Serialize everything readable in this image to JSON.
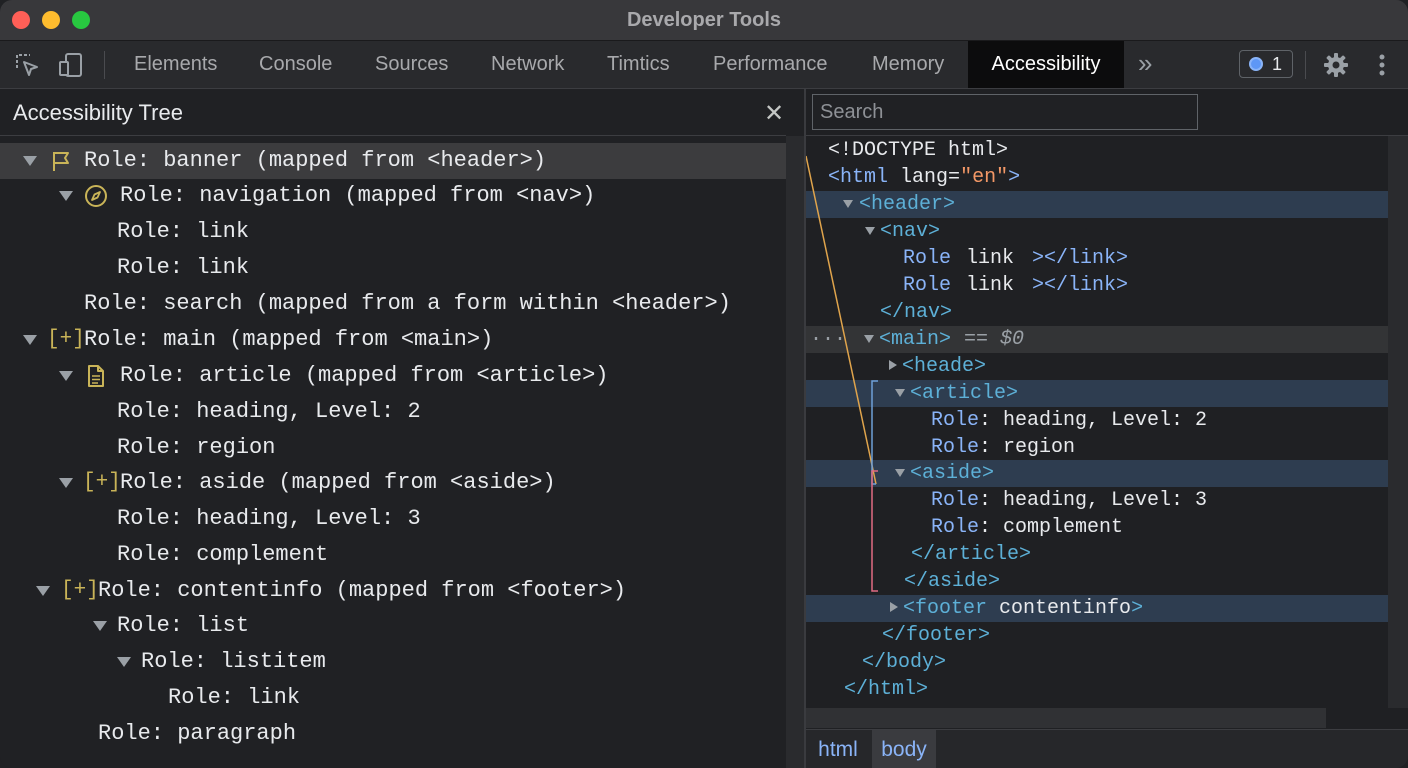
{
  "window": {
    "title": "Developer Tools"
  },
  "tabs": [
    "Elements",
    "Console",
    "Sources",
    "Network",
    "Timtics",
    "Performance",
    "Memory",
    "Accessibility"
  ],
  "active_tab": "Accessibility",
  "badge_count": "1",
  "left_pane": {
    "title": "Accessibility Tree",
    "rows": [
      "Role: banner (mapped from <header>)",
      "Role: navigation (mapped from <nav>)",
      "Role: link",
      "Role: link",
      "Role: search (mapped from a form within <header>)",
      "Role: main (mapped from <main>)",
      "Role: article (mapped from <article>)",
      "Role: heading, Level: 2",
      "Role: region",
      "Role: aside (mapped from <aside>)",
      "Role: heading, Level: 3",
      "Role: complement",
      "Role: contentinfo (mapped from <footer>)",
      "Role: list",
      "Role: listitem",
      "Role: link",
      "Role: paragraph"
    ],
    "plus_marker": "[+]"
  },
  "right_pane": {
    "search_placeholder": "Search",
    "dom": {
      "doctype": "<!DOCTYPE html>",
      "html_open": "<html",
      "html_attr": "lang",
      "html_eq": "=",
      "html_val": "\"en\"",
      "html_close": ">",
      "header": "<header>",
      "nav": "<nav>",
      "role_word": "Role",
      "link_word": "link",
      "link_close": "></link>",
      "link_close2": "></link>",
      "nav_end": "</nav>",
      "ellipsis": "···",
      "main": "<main>",
      "main_sel": "== $0",
      "heade": "<heade>",
      "article": "<article>",
      "r1_role": "Role",
      "r1_rest": ": heading, Level: 2",
      "r2_role": "Role",
      "r2_rest": ": region",
      "aside": "<aside>",
      "r3_role": "Role",
      "r3_rest": ": heading, Level: 3",
      "r4_role": "Role",
      "r4_rest": ": complement",
      "article_end": "</article>",
      "aside_end": "</aside>",
      "footer_open": "<footer",
      "footer_word": "contentinfo",
      "footer_gt": ">",
      "footer_end": "</footer>",
      "body_end": "</body>",
      "html_end": "</html>"
    },
    "breadcrumbs": [
      "html",
      "body"
    ]
  },
  "colors": {
    "accent": "#8ab4f8",
    "selected_row": "#3c3c3e",
    "highlight_row": "#2e3d50"
  }
}
